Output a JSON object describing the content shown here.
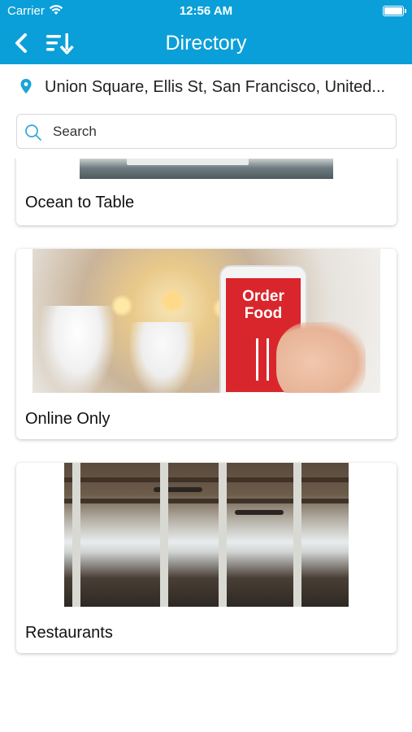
{
  "status_bar": {
    "carrier": "Carrier",
    "time": "12:56 AM"
  },
  "nav": {
    "title": "Directory"
  },
  "location": {
    "text": "Union Square, Ellis St, San Francisco, United..."
  },
  "search": {
    "placeholder": "Search"
  },
  "directory": {
    "items": [
      {
        "label": "Ocean to Table"
      },
      {
        "label": "Online Only",
        "image_text": "Order Food"
      },
      {
        "label": "Restaurants"
      }
    ]
  },
  "colors": {
    "primary": "#0a9fd8",
    "background": "#ffffff",
    "text": "#111111",
    "search_icon": "#3aa8d8"
  }
}
